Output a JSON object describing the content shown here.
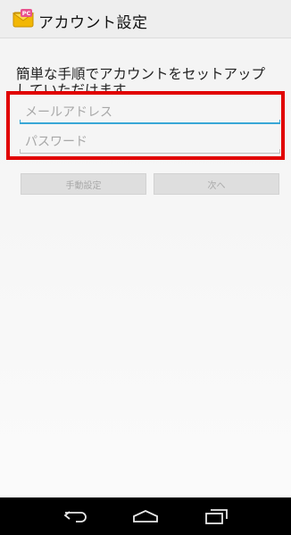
{
  "header": {
    "title": "アカウント設定",
    "icon": "pc-mail-app-icon"
  },
  "intro": {
    "text": "簡単な手順でアカウントをセットアップ\nしていただけます。"
  },
  "form": {
    "email_placeholder": "メールアドレス",
    "email_value": "",
    "password_placeholder": "パスワード",
    "password_value": ""
  },
  "buttons": {
    "manual_label": "手動設定",
    "next_label": "次へ"
  },
  "colors": {
    "highlight": "#e10000",
    "focus_underline": "#38a7d6"
  }
}
